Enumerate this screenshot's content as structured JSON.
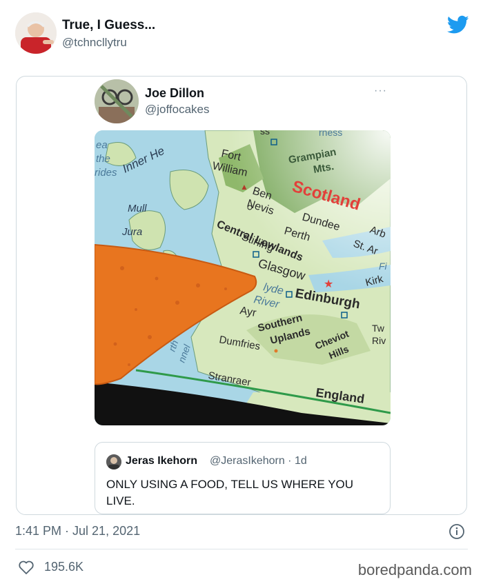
{
  "outer_tweet": {
    "author_name": "True, I Guess...",
    "author_handle": "@tchncllytru",
    "timestamp": "1:41 PM · Jul 21, 2021",
    "likes": "195.6K"
  },
  "quoted_tweet": {
    "author_name": "Joe Dillon",
    "author_handle": "@joffocakes",
    "more_label": "···"
  },
  "nested_quote": {
    "author_name": "Jeras Ikehorn",
    "author_handle_time": "@JerasIkehorn · 1d",
    "text": "ONLY USING A FOOD, TELL US WHERE YOU LIVE."
  },
  "map_labels": {
    "inner_hebrides": "Inner He",
    "sea_left": [
      "ea",
      "the",
      "rides"
    ],
    "mull": "Mull",
    "jura": "Jura",
    "fort_william": [
      "Fort",
      "William"
    ],
    "ben_nevis": [
      "Ben",
      "Nevis"
    ],
    "grampian": [
      "Grampian",
      "Mts."
    ],
    "highland_top": "ss",
    "highlands_top_right": "rness",
    "scotland": "Scotland",
    "dundee": "Dundee",
    "perth": "Perth",
    "arb": "Arb",
    "central_lowlands": "Central Lowlands",
    "stirling": "Stirling",
    "st_andrews": "St. Ar",
    "fif": "Fi",
    "glasgow": "Glasgow",
    "kirk": "Kirk",
    "clyde": "lyde",
    "river": "River",
    "edinburgh": "Edinburgh",
    "ayr": "Ayr",
    "southern_uplands": [
      "Southern",
      "Uplands"
    ],
    "cheviot_hills": [
      "Cheviot",
      "Hills"
    ],
    "tweed": [
      "Tw",
      "Riv"
    ],
    "dumfries": "Dumfries",
    "north_channel": [
      "rth",
      "nnel"
    ],
    "stranraer": "Stranraer",
    "england": "England"
  },
  "watermark": "boredpanda.com",
  "colors": {
    "twitter_blue": "#1d9bf0",
    "secondary_text": "#536471",
    "scotland_red": "#e2403a",
    "sea": "#a9d6e6",
    "lowland": "#cfe3b0",
    "highland": "#79a85a",
    "dorito": "#e8751f"
  },
  "icons": {
    "twitter": "twitter-bird-icon",
    "info": "info-icon",
    "like": "heart-icon",
    "more": "more-horizontal-icon"
  }
}
